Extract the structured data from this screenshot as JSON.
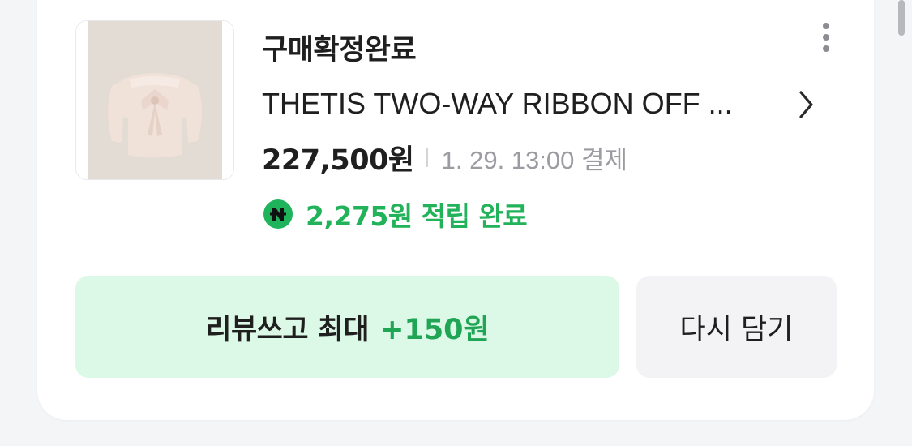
{
  "order": {
    "status": "구매확정완료",
    "product_name": "THETIS TWO-WAY RIBBON OFF ...",
    "price": "227,500원",
    "paid_date": "1. 29. 13:00 결제",
    "points_text": "2,275원 적립 완료",
    "thumbnail_icon": "product-thumbnail-sweater"
  },
  "actions": {
    "review_label": "리뷰쓰고 최대",
    "review_reward": "+150원",
    "recart_label": "다시 담기"
  },
  "icons": {
    "more": "more-vertical-icon",
    "chevron": "chevron-right-icon",
    "npay": "naver-pay-icon"
  },
  "colors": {
    "points_green": "#21b25a",
    "review_button_bg": "#dcf8e6",
    "review_reward_green": "#1fa554",
    "recart_button_bg": "#f3f3f5"
  }
}
